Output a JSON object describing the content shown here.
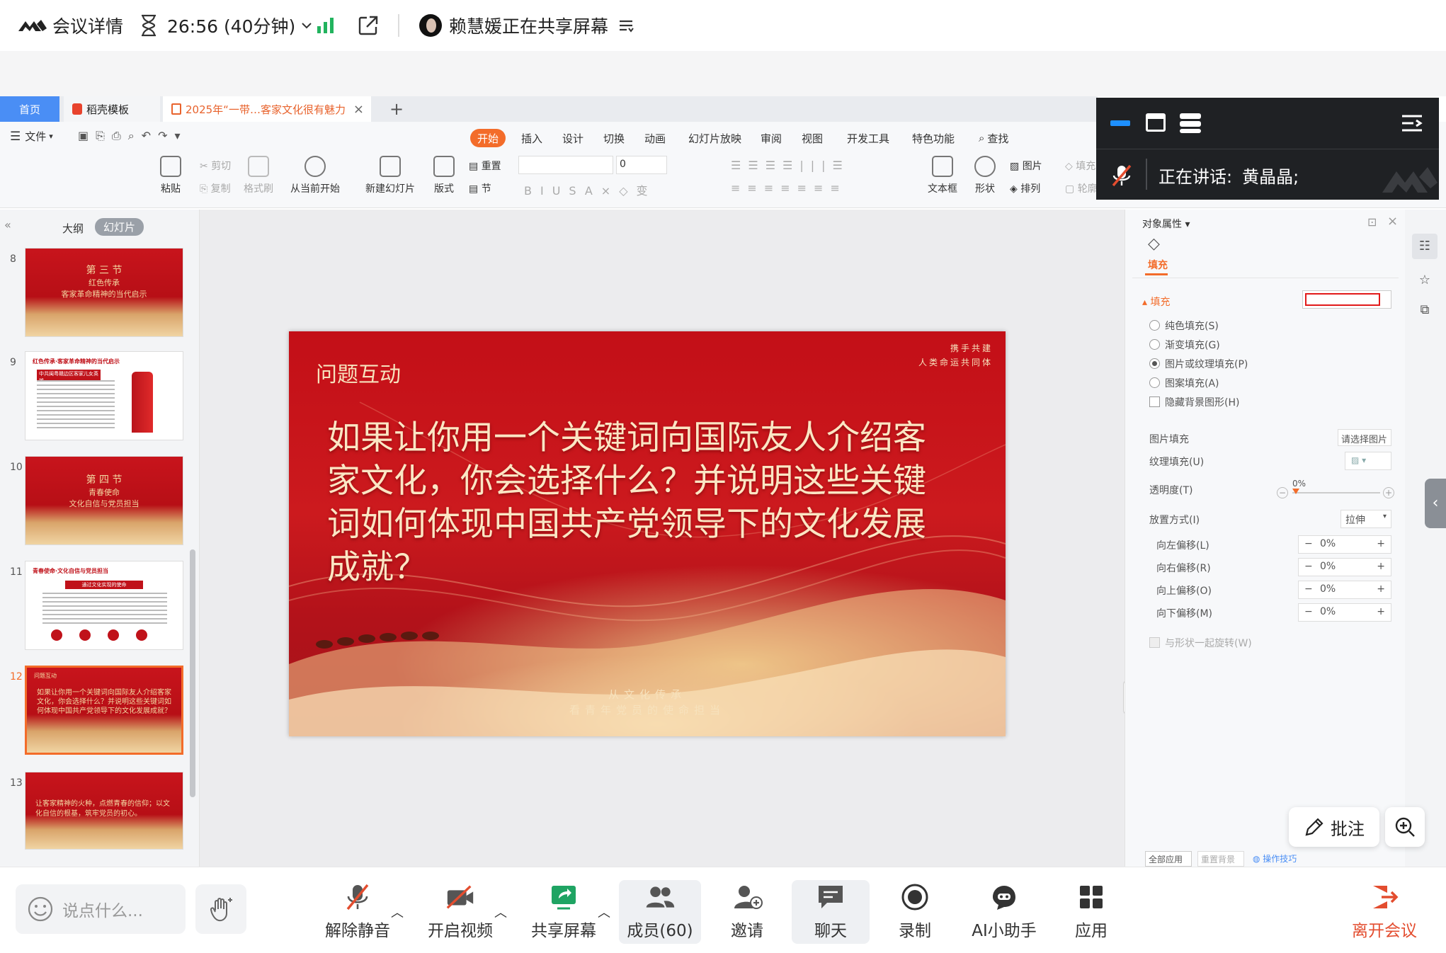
{
  "meeting": {
    "details_label": "会议详情",
    "timer": "26:56 (40分钟)",
    "sharer": "赖慧媛正在共享屏幕",
    "speaking_label": "正在讲话:",
    "speaking_name": "黄晶晶;"
  },
  "wps": {
    "tabs": [
      {
        "label": "首页"
      },
      {
        "label": "稻壳模板"
      },
      {
        "label": "2025年“一带…客家文化很有魅力"
      }
    ],
    "menu_file": "文件",
    "ribbon_tabs": [
      "开始",
      "插入",
      "设计",
      "切换",
      "动画",
      "幻灯片放映",
      "审阅",
      "视图",
      "开发工具",
      "特色功能",
      "查找"
    ],
    "ribbon_buttons": {
      "paste": "粘贴",
      "cut": "剪切",
      "copy": "复制",
      "format_painter": "格式刷",
      "play_from_current": "从当前开始",
      "new_slide": "新建幻灯片",
      "layout": "版式",
      "reset": "重置",
      "section": "节",
      "font_size": "0",
      "textbox": "文本框",
      "shape": "形状",
      "picture": "图片",
      "arrange": "排列",
      "fill": "填充",
      "outline": "轮廓"
    },
    "left_panel": {
      "outline_tab": "大纲",
      "slides_tab": "幻灯片",
      "thumbs": [
        {
          "num": "8",
          "lines": [
            "第 三 节",
            "红色传承",
            "客家革命精神的当代启示"
          ]
        },
        {
          "num": "9",
          "lines": [
            "红色传承·客家革命精神的当代启示",
            "中共闽粤赣边区客家儿女英雄"
          ]
        },
        {
          "num": "10",
          "lines": [
            "第 四 节",
            "青春使命",
            "文化自信与党员担当"
          ]
        },
        {
          "num": "11",
          "lines": [
            "青春使命·文化自信与党员担当",
            "通过文化实现的使命"
          ]
        },
        {
          "num": "12",
          "lines": [
            "问题互动",
            "如果让你用一个关键词向国际友人介绍客家文化，你会选择什么？并说明这些关键词如何体现中国共产党领导下的文化发展成就？"
          ]
        },
        {
          "num": "13",
          "lines": [
            "让客家精神的火种，点燃青春的信仰；以文化自信的根基，筑牢党员的初心。"
          ]
        }
      ]
    },
    "slide": {
      "corner_line1": "携手共建",
      "corner_line2": "人类命运共同体",
      "section_title": "问题互动",
      "main_text": "如果让你用一个关键词向国际友人介绍客家文化，你会选择什么？并说明这些关键词如何体现中国共产党领导下的文化发展成就？",
      "footer_line1": "从文化传承",
      "footer_line2": "看青年党员的使命担当"
    },
    "properties": {
      "title": "对象属性",
      "fill_tab": "填充",
      "fill_section": "填充",
      "fill_color": "#e21a1a",
      "options": [
        "纯色填充(S)",
        "渐变填充(G)",
        "图片或纹理填充(P)",
        "图案填充(A)"
      ],
      "selected_option": "图片或纹理填充(P)",
      "hide_bg": "隐藏背景图形(H)",
      "picture_fill": "图片填充",
      "choose_picture": "请选择图片",
      "texture_fill": "纹理填充(U)",
      "transparency": "透明度(T)",
      "transparency_value": "0%",
      "placement": "放置方式(I)",
      "placement_value": "拉伸",
      "offsets": [
        {
          "label": "向左偏移(L)",
          "value": "0%"
        },
        {
          "label": "向右偏移(R)",
          "value": "0%"
        },
        {
          "label": "向上偏移(O)",
          "value": "0%"
        },
        {
          "label": "向下偏移(M)",
          "value": "0%"
        }
      ],
      "rotate_with_shape": "与形状一起旋转(W)",
      "apply_all": "全部应用",
      "reset_bg": "重置背景",
      "tips": "操作技巧"
    }
  },
  "annotate": "批注",
  "bottom": {
    "chat_placeholder": "说点什么...",
    "unmute": "解除静音",
    "start_video": "开启视频",
    "share_screen": "共享屏幕",
    "members": "成员(60)",
    "invite": "邀请",
    "chat": "聊天",
    "record": "录制",
    "ai_assistant": "AI小助手",
    "apps": "应用",
    "leave": "离开会议"
  },
  "colors": {
    "wps_orange": "#f36c2a",
    "leave_red": "#e34d2f",
    "share_green": "#1fa463",
    "signal_green": "#22b35e",
    "slide_red": "#c30f17"
  }
}
